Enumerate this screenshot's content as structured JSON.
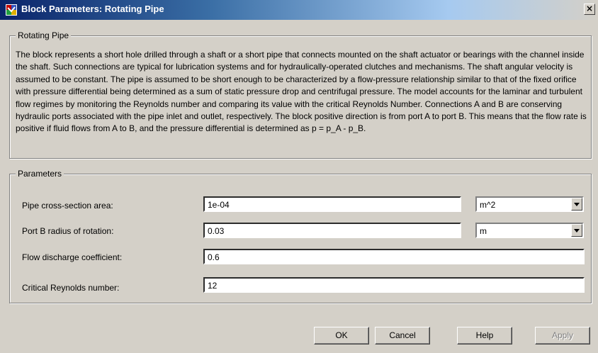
{
  "window": {
    "title": "Block Parameters: Rotating Pipe",
    "close_label": "×"
  },
  "description_group": {
    "legend": "Rotating Pipe",
    "text": "The block represents a short hole drilled through a shaft or a short pipe that connects mounted on the shaft actuator or bearings with the channel inside the shaft. Such connections are typical for lubrication systems and for hydraulically-operated clutches and mechanisms. The shaft angular velocity is assumed to be constant. The pipe is assumed to be short enough to be characterized by a flow-pressure relationship similar to that of the fixed orifice with pressure differential being determined as a sum of static pressure drop and centrifugal pressure. The model accounts for the laminar and turbulent flow regimes by monitoring the Reynolds number and comparing its value with the critical Reynolds Number. Connections A and B are conserving hydraulic ports associated with the pipe inlet and outlet, respectively. The block positive direction is from port A to port B. This means that the flow rate is positive if fluid flows from A to B, and the pressure differential is determined as p = p_A - p_B."
  },
  "parameters_group": {
    "legend": "Parameters",
    "fields": [
      {
        "label": "Pipe cross-section area:",
        "value": "1e-04",
        "unit": "m^2"
      },
      {
        "label": "Port B radius of rotation:",
        "value": "0.03",
        "unit": "m"
      },
      {
        "label": "Flow discharge coefficient:",
        "value": "0.6"
      },
      {
        "label": "Critical Reynolds number:",
        "value": "12"
      }
    ]
  },
  "buttons": {
    "ok": "OK",
    "cancel": "Cancel",
    "help": "Help",
    "apply": "Apply"
  }
}
